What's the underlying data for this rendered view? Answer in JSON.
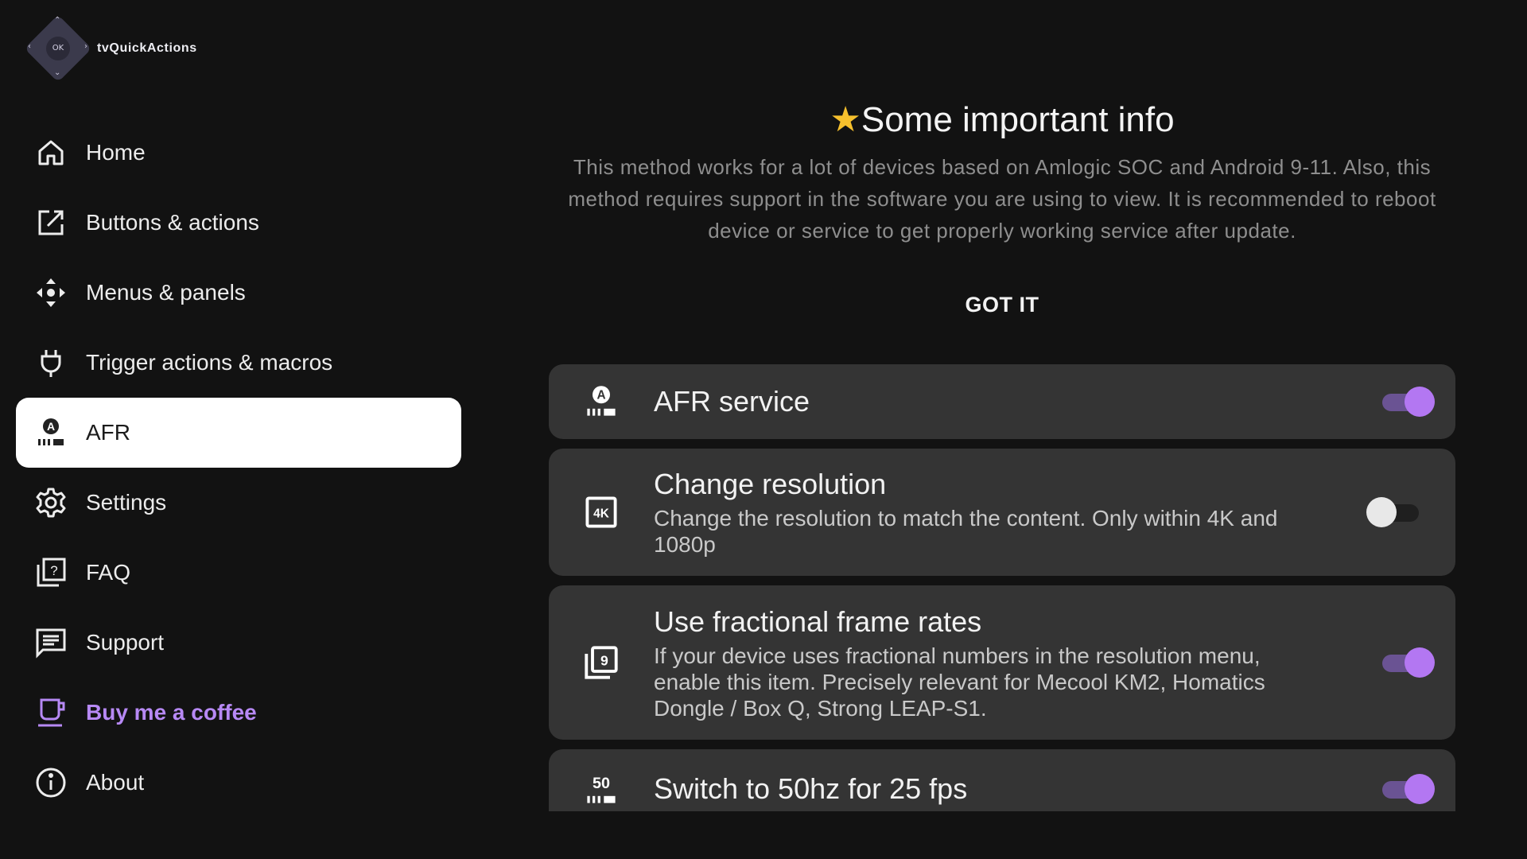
{
  "app": {
    "name": "tvQuickActions",
    "logo_center": "OK"
  },
  "sidebar": {
    "items": [
      {
        "label": "Home",
        "icon": "home-icon",
        "active": false
      },
      {
        "label": "Buttons & actions",
        "icon": "open-in-new-icon",
        "active": false
      },
      {
        "label": "Menus & panels",
        "icon": "dpad-icon",
        "active": false
      },
      {
        "label": "Trigger actions & macros",
        "icon": "plug-icon",
        "active": false
      },
      {
        "label": "AFR",
        "icon": "afr-icon",
        "active": true
      },
      {
        "label": "Settings",
        "icon": "gear-icon",
        "active": false
      },
      {
        "label": "FAQ",
        "icon": "help-library-icon",
        "active": false
      },
      {
        "label": "Support",
        "icon": "chat-icon",
        "active": false
      },
      {
        "label": "Buy me a coffee",
        "icon": "coffee-cup-icon",
        "active": false,
        "accent": "#b789f5"
      },
      {
        "label": "About",
        "icon": "info-icon",
        "active": false
      }
    ]
  },
  "info": {
    "star": "★",
    "title": "Some important info",
    "body": "This method works for a lot of devices based on Amlogic SOC and Android 9-11. Also, this method requires support in the software you are using to view. It is recommended to reboot device or service to get properly working service after update.",
    "button": "GOT IT"
  },
  "settings": [
    {
      "title": "AFR service",
      "description": "",
      "icon": "afr-icon",
      "enabled": true
    },
    {
      "title": "Change resolution",
      "description": "Change the resolution to match the content. Only within 4K and 1080p",
      "icon": "4k-icon",
      "enabled": false
    },
    {
      "title": "Use fractional frame rates",
      "description": "If your device uses fractional numbers in the resolution menu, enable this item. Precisely relevant for Mecool KM2, Homatics Dongle / Box Q, Strong LEAP-S1.",
      "icon": "filter-9-icon",
      "enabled": true
    },
    {
      "title": "Switch to 50hz for 25 fps",
      "description": "",
      "icon": "fps-50-icon",
      "icon_text": "50",
      "enabled": true
    }
  ],
  "colors": {
    "background": "#121212",
    "card": "#343434",
    "accent": "#b377f2",
    "star": "#f6c02d"
  }
}
